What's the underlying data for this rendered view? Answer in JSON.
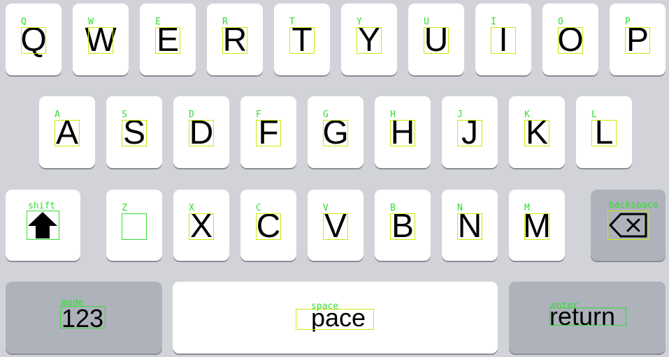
{
  "rows": [
    [
      {
        "id": "q",
        "label": "Q",
        "tag": "Q"
      },
      {
        "id": "w",
        "label": "W",
        "tag": "W"
      },
      {
        "id": "e",
        "label": "E",
        "tag": "E"
      },
      {
        "id": "r",
        "label": "R",
        "tag": "R"
      },
      {
        "id": "t",
        "label": "T",
        "tag": "T"
      },
      {
        "id": "y",
        "label": "Y",
        "tag": "Y"
      },
      {
        "id": "u",
        "label": "U",
        "tag": "U"
      },
      {
        "id": "i",
        "label": "I",
        "tag": "I"
      },
      {
        "id": "o",
        "label": "O",
        "tag": "O"
      },
      {
        "id": "p",
        "label": "P",
        "tag": "P"
      }
    ],
    [
      {
        "id": "a",
        "label": "A",
        "tag": "A"
      },
      {
        "id": "s",
        "label": "S",
        "tag": "S"
      },
      {
        "id": "d",
        "label": "D",
        "tag": "D"
      },
      {
        "id": "f",
        "label": "F",
        "tag": "F"
      },
      {
        "id": "g",
        "label": "G",
        "tag": "G"
      },
      {
        "id": "h",
        "label": "H",
        "tag": "H"
      },
      {
        "id": "j",
        "label": "J",
        "tag": "J"
      },
      {
        "id": "k",
        "label": "K",
        "tag": "K"
      },
      {
        "id": "l",
        "label": "L",
        "tag": "L"
      }
    ],
    [
      {
        "id": "z",
        "label": "",
        "tag": "Z"
      },
      {
        "id": "x",
        "label": "X",
        "tag": "X"
      },
      {
        "id": "c",
        "label": "C",
        "tag": "C"
      },
      {
        "id": "v",
        "label": "V",
        "tag": "V"
      },
      {
        "id": "b",
        "label": "B",
        "tag": "B"
      },
      {
        "id": "n",
        "label": "N",
        "tag": "N"
      },
      {
        "id": "m",
        "label": "M",
        "tag": "M"
      }
    ]
  ],
  "special": {
    "shift": {
      "tag": "shift",
      "icon": "shift-arrow-icon"
    },
    "backspace": {
      "tag": "backspace",
      "icon": "backspace-icon"
    },
    "mode": {
      "tag": "mode",
      "label": "123"
    },
    "space": {
      "tag": "space",
      "label": "pace"
    },
    "enter": {
      "tag": "enter",
      "label": "return"
    }
  },
  "colors": {
    "background": "#d1d3d9",
    "key": "#ffffff",
    "dark_key": "#adb2bb",
    "annotation": "#33dd33"
  }
}
